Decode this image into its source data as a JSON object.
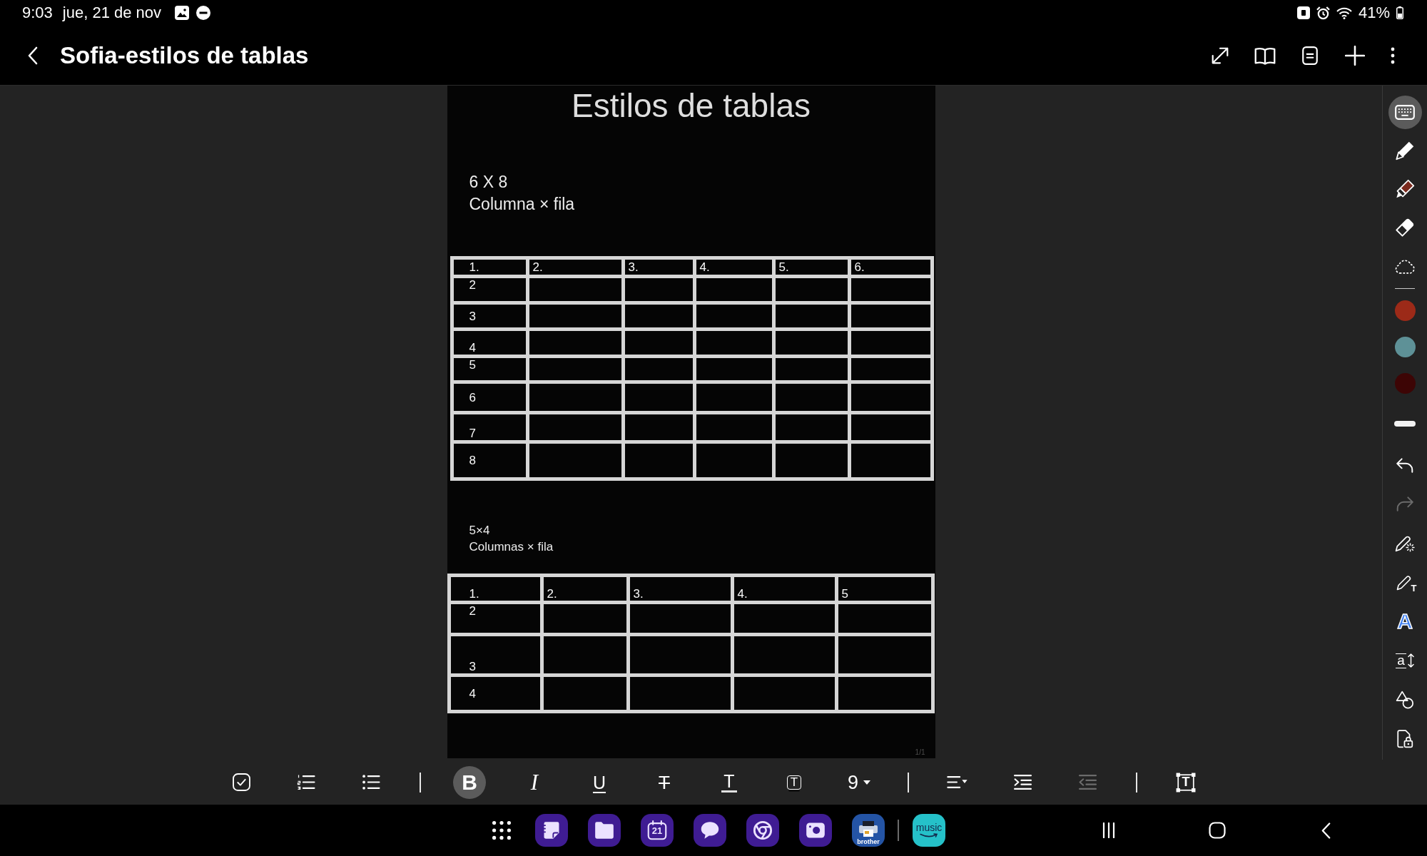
{
  "status_bar": {
    "time": "9:03",
    "date": "jue, 21 de nov",
    "battery_percent": "41%"
  },
  "title_bar": {
    "title": "Sofia-estilos de tablas"
  },
  "document": {
    "title": "Estilos de tablas",
    "sections": [
      {
        "heading": "6 X 8",
        "subheading": "Columna × fila",
        "table": {
          "header": [
            "1.",
            "2.",
            "3.",
            "4.",
            "5.",
            "6."
          ],
          "row_labels": [
            "2",
            "3",
            "4",
            "5",
            "6",
            "7",
            "8"
          ]
        }
      },
      {
        "heading": "5×4",
        "subheading": "Columnas × fila",
        "table": {
          "header": [
            "1.",
            "2.",
            "3.",
            "4.",
            "5"
          ],
          "row_labels": [
            "2",
            "3",
            "4"
          ]
        }
      }
    ],
    "page_number": "1/1"
  },
  "pen_toolbar": {
    "tools": [
      {
        "kind": "keyboard",
        "selected": true
      },
      {
        "kind": "pen",
        "selected": false
      },
      {
        "kind": "highlighter",
        "selected": false
      },
      {
        "kind": "eraser",
        "selected": false
      },
      {
        "kind": "lasso",
        "selected": false
      }
    ],
    "colors": [
      {
        "color": "#9c2a18"
      },
      {
        "color": "#5e9197"
      },
      {
        "color": "#3d0505"
      }
    ],
    "history": [
      {
        "kind": "undo",
        "disabled": false
      },
      {
        "kind": "redo",
        "disabled": true
      }
    ],
    "more_tools": [
      {
        "kind": "magic-pen"
      },
      {
        "kind": "pen-to-text",
        "label": "T"
      },
      {
        "kind": "text-style",
        "label": "A"
      },
      {
        "kind": "text-size",
        "label": "a"
      },
      {
        "kind": "shapes"
      },
      {
        "kind": "lock"
      }
    ]
  },
  "format_toolbar": {
    "list_buttons": [
      {
        "kind": "checklist"
      },
      {
        "kind": "numbered-list"
      },
      {
        "kind": "bullet-list"
      }
    ],
    "style_buttons": [
      {
        "kind": "bold",
        "label": "B",
        "on": true
      },
      {
        "kind": "italic",
        "label": "I",
        "on": false
      },
      {
        "kind": "underline",
        "label": "U",
        "on": false
      },
      {
        "kind": "strikethrough",
        "label": "T",
        "on": false
      },
      {
        "kind": "font-color",
        "label": "T",
        "on": false
      },
      {
        "kind": "highlight",
        "label": "T",
        "on": false
      }
    ],
    "font_size": "9",
    "paragraph_buttons": [
      {
        "kind": "align",
        "disabled": false
      },
      {
        "kind": "indent",
        "disabled": false
      },
      {
        "kind": "outdent",
        "disabled": true
      }
    ],
    "insert_buttons": [
      {
        "kind": "text-box",
        "label": "T"
      }
    ]
  },
  "taskbar": {
    "apps": [
      {
        "kind": "notes"
      },
      {
        "kind": "files"
      },
      {
        "kind": "calendar",
        "label": "21"
      },
      {
        "kind": "messages"
      },
      {
        "kind": "browser"
      },
      {
        "kind": "camera"
      },
      {
        "kind": "printer",
        "label": "brother"
      }
    ],
    "recent_apps": [
      {
        "kind": "music",
        "label": "music"
      }
    ]
  }
}
